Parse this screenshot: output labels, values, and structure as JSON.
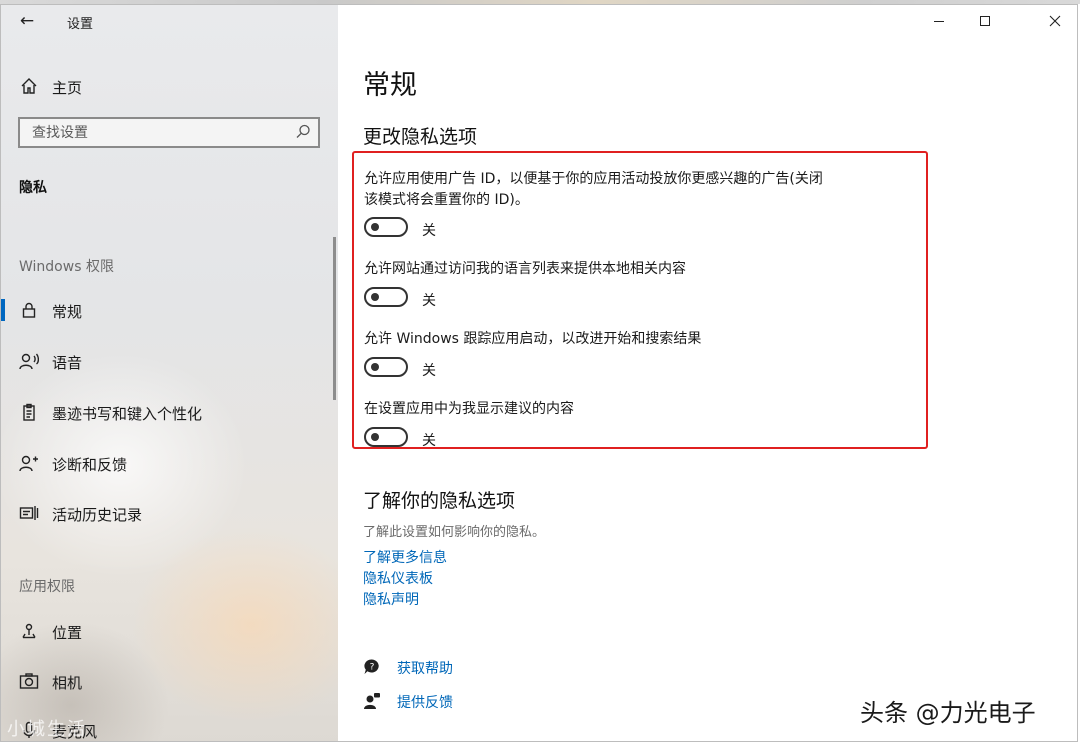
{
  "window": {
    "title": "设置"
  },
  "sidebar": {
    "home_label": "主页",
    "search_placeholder": "查找设置",
    "section_heading": "隐私",
    "group_windows": "Windows 权限",
    "group_app": "应用权限",
    "items": [
      {
        "label": "常规",
        "icon": "lock-icon",
        "active": true
      },
      {
        "label": "语音",
        "icon": "voice-icon"
      },
      {
        "label": "墨迹书写和键入个性化",
        "icon": "clipboard-icon"
      },
      {
        "label": "诊断和反馈",
        "icon": "diagnostics-icon"
      },
      {
        "label": "活动历史记录",
        "icon": "timeline-icon"
      },
      {
        "label": "位置",
        "icon": "location-icon"
      },
      {
        "label": "相机",
        "icon": "camera-icon"
      },
      {
        "label": "麦克风",
        "icon": "microphone-icon"
      }
    ],
    "watermark": "小城生活"
  },
  "main": {
    "page_title": "常规",
    "section_title": "更改隐私选项",
    "options": [
      {
        "description": "允许应用使用广告 ID，以便基于你的应用活动投放你更感兴趣的广告(关闭该模式将会重置你的 ID)。",
        "state": "关",
        "enabled": false
      },
      {
        "description": "允许网站通过访问我的语言列表来提供本地相关内容",
        "state": "关",
        "enabled": false
      },
      {
        "description": "允许 Windows 跟踪应用启动，以改进开始和搜索结果",
        "state": "关",
        "enabled": false
      },
      {
        "description": "在设置应用中为我显示建议的内容",
        "state": "关",
        "enabled": false
      }
    ],
    "info_title": "了解你的隐私选项",
    "info_desc": "了解此设置如何影响你的隐私。",
    "links": [
      "了解更多信息",
      "隐私仪表板",
      "隐私声明"
    ],
    "help": {
      "get_help": "获取帮助",
      "feedback": "提供反馈"
    },
    "watermark": "头条 @力光电子"
  },
  "colors": {
    "accent": "#0067c0",
    "link": "#0067b8",
    "highlight": "#e02020"
  }
}
